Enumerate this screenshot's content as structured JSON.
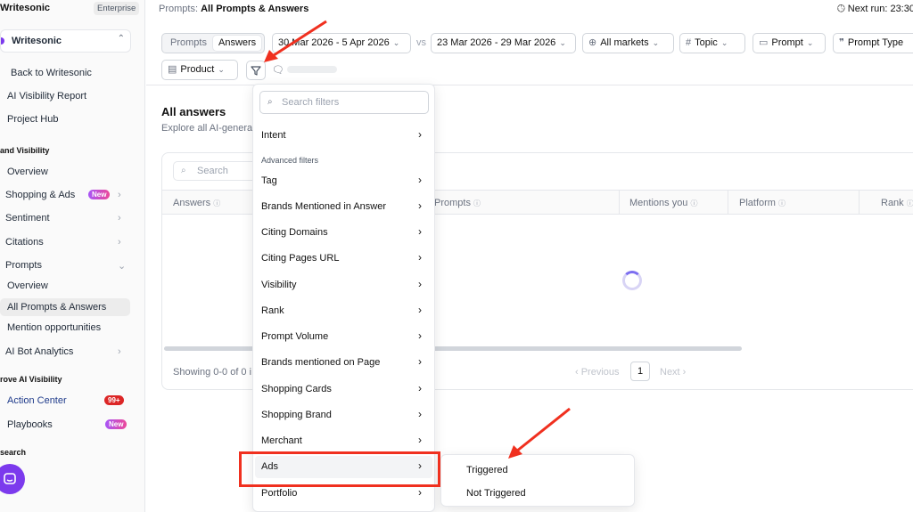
{
  "sidebar": {
    "brand": "Writesonic",
    "plan": "Enterprise",
    "workspace": "Writesonic",
    "back_label": "Back to Writesonic",
    "report_label": "AI Visibility Report",
    "hub_label": "Project Hub",
    "section_brand": "and Visibility",
    "overview_label": "Overview",
    "shopping_label": "Shopping & Ads",
    "shopping_badge": "New",
    "sentiment_label": "Sentiment",
    "citations_label": "Citations",
    "prompts_label": "Prompts",
    "prompts_overview_label": "Overview",
    "all_prompts_label": "All Prompts & Answers",
    "mention_label": "Mention opportunities",
    "ai_bot_label": "AI Bot Analytics",
    "section_improve": "rove AI Visibility",
    "action_center_label": "Action Center",
    "action_center_badge": "99+",
    "playbooks_label": "Playbooks",
    "playbooks_badge": "New",
    "section_research": "search"
  },
  "header": {
    "breadcrumb_prefix": "Prompts:",
    "breadcrumb_current": "All Prompts & Answers",
    "next_run": "Next run: 23:30"
  },
  "filters": {
    "seg_prompts": "Prompts",
    "seg_answers": "Answers",
    "date_range_1": "30 Mar 2026 - 5 Apr 2026",
    "vs": "vs",
    "date_range_2": "23 Mar 2026 - 29 Mar 2026",
    "markets": "All markets",
    "topic": "Topic",
    "prompt": "Prompt",
    "prompt_type": "Prompt Type",
    "product": "Product"
  },
  "main": {
    "title": "All answers",
    "subtitle": "Explore all AI-generat",
    "search_placeholder": "Search",
    "columns": [
      "Answers",
      "Prompts",
      "Mentions you",
      "Platform",
      "Rank"
    ],
    "showing": "Showing 0-0 of 0 i",
    "prev": "‹ Previous",
    "page": "1",
    "next": "Next ›"
  },
  "dropdown": {
    "search_placeholder": "Search filters",
    "intent": "Intent",
    "advanced_section": "Advanced filters",
    "items": [
      "Tag",
      "Brands Mentioned in Answer",
      "Citing Domains",
      "Citing Pages URL",
      "Visibility",
      "Rank",
      "Prompt Volume",
      "Brands mentioned on Page",
      "Shopping Cards",
      "Shopping Brand",
      "Merchant",
      "Ads",
      "Portfolio"
    ],
    "highlighted": "Ads"
  },
  "submenu": {
    "items": [
      "Triggered",
      "Not Triggered"
    ]
  },
  "colors": {
    "accent": "#7c3aed",
    "annotation": "#f0301f",
    "badge_red": "#dc2626"
  }
}
